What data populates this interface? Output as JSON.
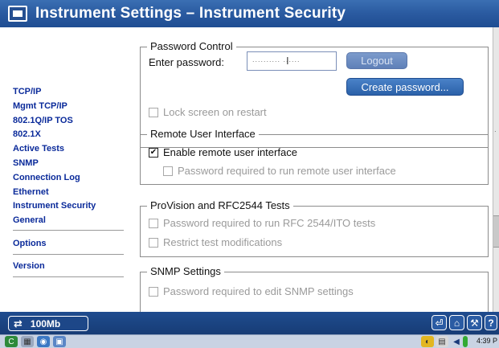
{
  "window": {
    "title": "Instrument Settings – Instrument Security"
  },
  "nav": {
    "items": [
      {
        "label": "TCP/IP"
      },
      {
        "label": "Mgmt TCP/IP"
      },
      {
        "label": "802.1Q/IP TOS"
      },
      {
        "label": "802.1X"
      },
      {
        "label": "Active Tests"
      },
      {
        "label": "SNMP"
      },
      {
        "label": "Connection Log"
      },
      {
        "label": "Ethernet"
      },
      {
        "label": "Instrument Security"
      },
      {
        "label": "General"
      }
    ],
    "options_label": "Options",
    "version_label": "Version"
  },
  "password_control": {
    "legend": "Password Control",
    "enter_label": "Enter password:",
    "password_value": "",
    "logout_label": "Logout",
    "create_label": "Create password...",
    "lock_screen_label": "Lock screen on restart",
    "lock_screen_checked": false
  },
  "remote_ui": {
    "legend": "Remote User Interface",
    "enable_label": "Enable remote user interface",
    "enable_checked": true,
    "pw_required_label": "Password required to run remote user interface",
    "pw_required_checked": false
  },
  "provision": {
    "legend": "ProVision and RFC2544 Tests",
    "pw_rfc_label": "Password required to run RFC 2544/ITO tests",
    "pw_rfc_checked": false,
    "restrict_label": "Restrict test modifications",
    "restrict_checked": false
  },
  "snmp": {
    "legend": "SNMP Settings",
    "pw_snmp_label": "Password required to edit SNMP settings",
    "pw_snmp_checked": false
  },
  "statusbar": {
    "link_speed": "100Mb",
    "link_icon": "swap-arrows-icon"
  },
  "taskbar": {
    "clock": "4:39 P"
  },
  "colors": {
    "title_bar": "#2a5aa0",
    "nav_link": "#0a2a9a",
    "status_bar": "#1f4c8f"
  }
}
